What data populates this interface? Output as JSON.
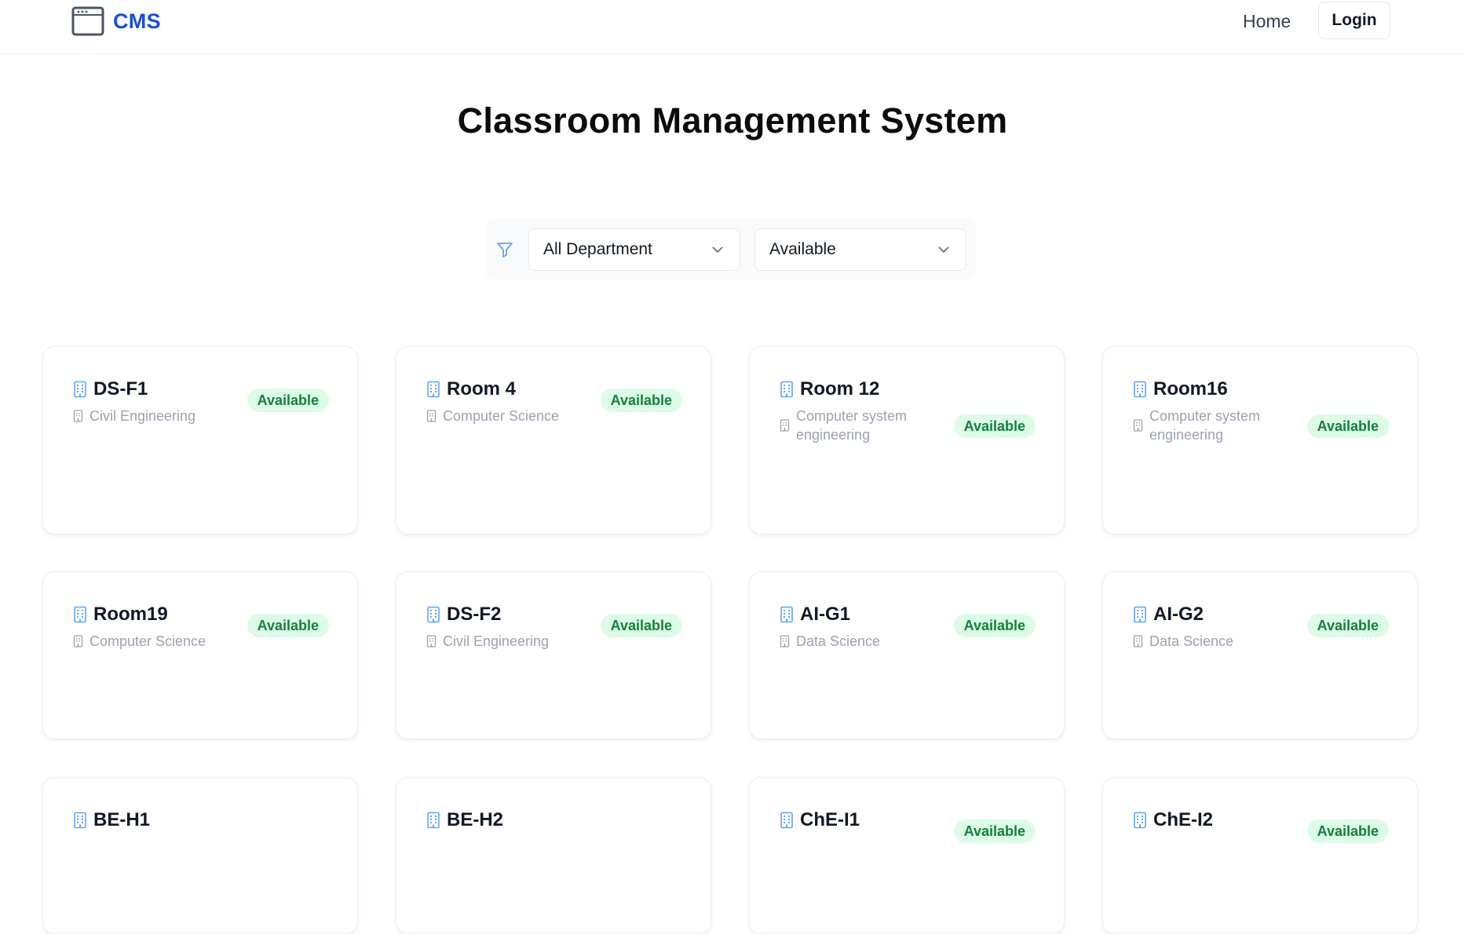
{
  "nav": {
    "brand": "CMS",
    "home": "Home",
    "login": "Login"
  },
  "page": {
    "title": "Classroom Management System"
  },
  "filters": {
    "department": "All Department",
    "status": "Available"
  },
  "rooms": [
    {
      "name": "DS-F1",
      "department": "Civil Engineering",
      "status": "Available"
    },
    {
      "name": "Room 4",
      "department": "Computer Science",
      "status": "Available"
    },
    {
      "name": "Room 12",
      "department": "Computer system engineering",
      "status": "Available"
    },
    {
      "name": "Room16",
      "department": "Computer system engineering",
      "status": "Available"
    },
    {
      "name": "Room19",
      "department": "Computer Science",
      "status": "Available"
    },
    {
      "name": "DS-F2",
      "department": "Civil Engineering",
      "status": "Available"
    },
    {
      "name": "AI-G1",
      "department": "Data Science",
      "status": "Available"
    },
    {
      "name": "AI-G2",
      "department": "Data Science",
      "status": "Available"
    },
    {
      "name": "BE-H1",
      "department": "",
      "status": ""
    },
    {
      "name": "BE-H2",
      "department": "",
      "status": ""
    },
    {
      "name": "ChE-I1",
      "department": "",
      "status": "Available"
    },
    {
      "name": "ChE-I2",
      "department": "",
      "status": "Available"
    }
  ],
  "colors": {
    "brand": "#1d4ed8",
    "badge_bg": "#dcfce7",
    "badge_text": "#15803d",
    "icon": "#60a5fa"
  }
}
